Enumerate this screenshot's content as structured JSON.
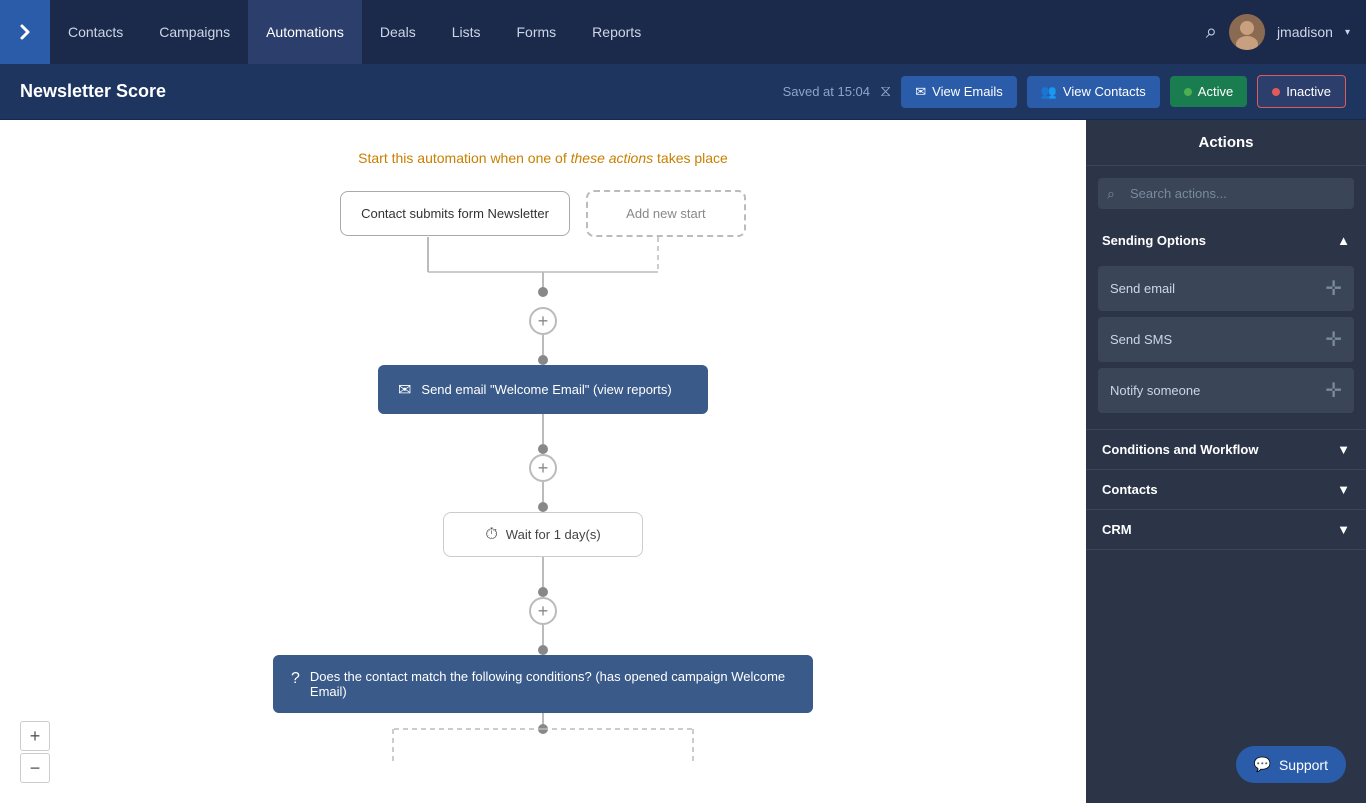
{
  "nav": {
    "logo_icon": "chevron-right",
    "links": [
      "Contacts",
      "Campaigns",
      "Automations",
      "Deals",
      "Lists",
      "Forms",
      "Reports"
    ],
    "active_link": "Automations",
    "username": "jmadison"
  },
  "sub_header": {
    "title": "Newsletter Score",
    "saved_text": "Saved at 15:04",
    "btn_view_emails": "View Emails",
    "btn_view_contacts": "View Contacts",
    "btn_active": "Active",
    "btn_inactive": "Inactive"
  },
  "canvas": {
    "start_text": "Start this automation when one of",
    "start_text_highlight": "these actions",
    "start_text_end": "takes place",
    "trigger_label": "Contact submits form Newsletter",
    "add_new_start": "Add new start",
    "node_email_label": "Send email \"Welcome Email\" (view reports)",
    "node_wait_label": "Wait for 1 day(s)",
    "node_condition_label": "Does the contact match the following conditions? (has opened campaign Welcome Email)"
  },
  "sidebar": {
    "header": "Actions",
    "search_placeholder": "Search actions...",
    "sections": [
      {
        "label": "Sending Options",
        "expanded": true,
        "items": [
          "Send email",
          "Send SMS",
          "Notify someone"
        ]
      },
      {
        "label": "Conditions and Workflow",
        "expanded": false,
        "items": []
      },
      {
        "label": "Contacts",
        "expanded": false,
        "items": []
      },
      {
        "label": "CRM",
        "expanded": false,
        "items": []
      }
    ],
    "support_label": "Support"
  },
  "colors": {
    "nav_bg": "#1b2a4a",
    "sub_header_bg": "#1e3560",
    "sidebar_bg": "#2c3548",
    "node_bg": "#3a5a8a",
    "active_color": "#4caf50",
    "inactive_color": "#e05a5a"
  }
}
